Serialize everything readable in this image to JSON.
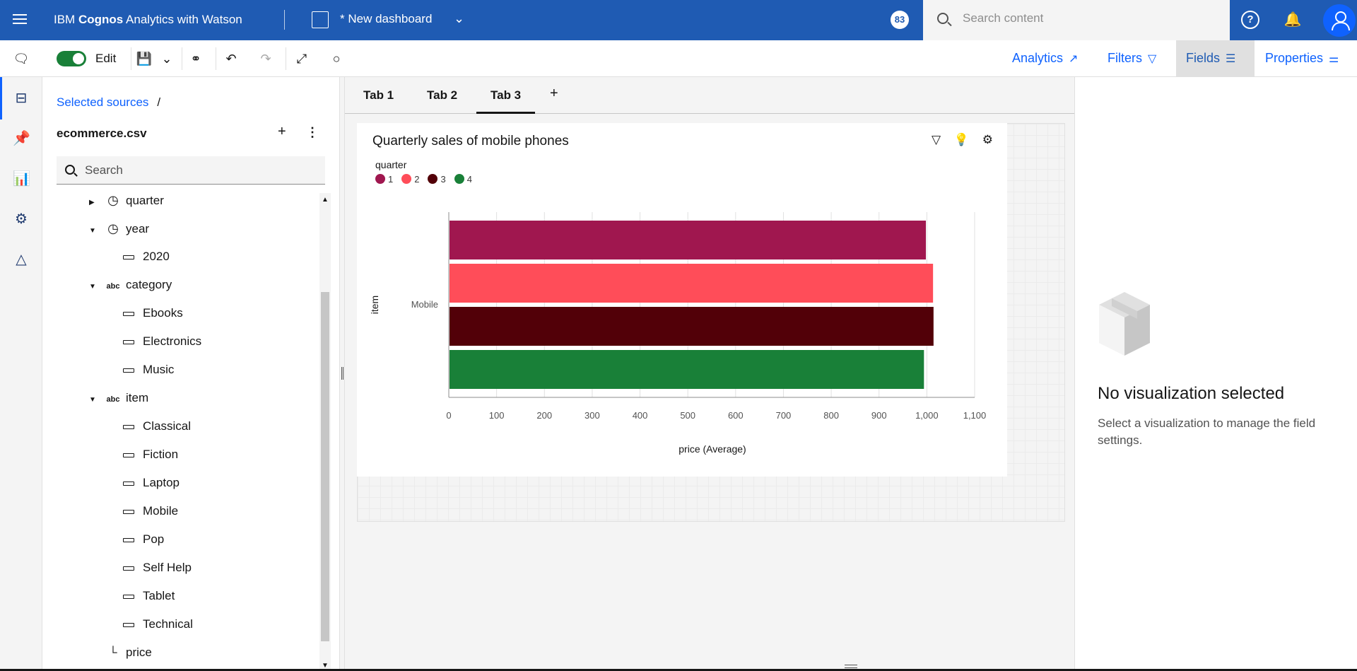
{
  "header": {
    "brand_prefix": "IBM ",
    "brand_bold": "Cognos",
    "brand_suffix": " Analytics with Watson",
    "dashboard_title": "* New dashboard",
    "notification_count": "83",
    "search_placeholder": "Search content"
  },
  "toolbar": {
    "edit_label": "Edit",
    "right_tabs": [
      "Analytics",
      "Filters",
      "Fields",
      "Properties"
    ]
  },
  "panel": {
    "breadcrumb": "Selected sources",
    "breadcrumb_sep": "/",
    "source_name": "ecommerce.csv",
    "search_placeholder": "Search",
    "tree": [
      {
        "label": "quarter",
        "type": "time",
        "level": 0,
        "expanded": false
      },
      {
        "label": "year",
        "type": "time",
        "level": 0,
        "expanded": true
      },
      {
        "label": "2020",
        "type": "member",
        "level": 1
      },
      {
        "label": "category",
        "type": "text",
        "level": 0,
        "expanded": true
      },
      {
        "label": "Ebooks",
        "type": "member",
        "level": 1
      },
      {
        "label": "Electronics",
        "type": "member",
        "level": 1
      },
      {
        "label": "Music",
        "type": "member",
        "level": 1
      },
      {
        "label": "item",
        "type": "text",
        "level": 0,
        "expanded": true
      },
      {
        "label": "Classical",
        "type": "member",
        "level": 1
      },
      {
        "label": "Fiction",
        "type": "member",
        "level": 1
      },
      {
        "label": "Laptop",
        "type": "member",
        "level": 1
      },
      {
        "label": "Mobile",
        "type": "member",
        "level": 1
      },
      {
        "label": "Pop",
        "type": "member",
        "level": 1
      },
      {
        "label": "Self Help",
        "type": "member",
        "level": 1
      },
      {
        "label": "Tablet",
        "type": "member",
        "level": 1
      },
      {
        "label": "Technical",
        "type": "member",
        "level": 1
      },
      {
        "label": "price",
        "type": "measure",
        "level": 0
      }
    ]
  },
  "canvas": {
    "tabs": [
      "Tab 1",
      "Tab 2",
      "Tab 3"
    ],
    "active_tab": 2
  },
  "widget": {
    "title": "Quarterly sales of mobile phones"
  },
  "chart_data": {
    "type": "bar",
    "orientation": "horizontal",
    "title": "Quarterly sales of mobile phones",
    "xlabel": "price (Average)",
    "ylabel": "item",
    "categories": [
      "Mobile"
    ],
    "legend_title": "quarter",
    "legend_position": "top-left",
    "series": [
      {
        "name": "1",
        "values": [
          998
        ],
        "color": "#a0174f"
      },
      {
        "name": "2",
        "values": [
          1013
        ],
        "color": "#ff4d59"
      },
      {
        "name": "3",
        "values": [
          1014
        ],
        "color": "#520008"
      },
      {
        "name": "4",
        "values": [
          994
        ],
        "color": "#198038"
      }
    ],
    "xlim": [
      0,
      1100
    ],
    "xticks": [
      "0",
      "100",
      "200",
      "300",
      "400",
      "500",
      "600",
      "700",
      "800",
      "900",
      "1,000",
      "1,100"
    ],
    "grid": true
  },
  "right_panel": {
    "title": "No visualization selected",
    "text": "Select a visualization to manage the field settings."
  }
}
